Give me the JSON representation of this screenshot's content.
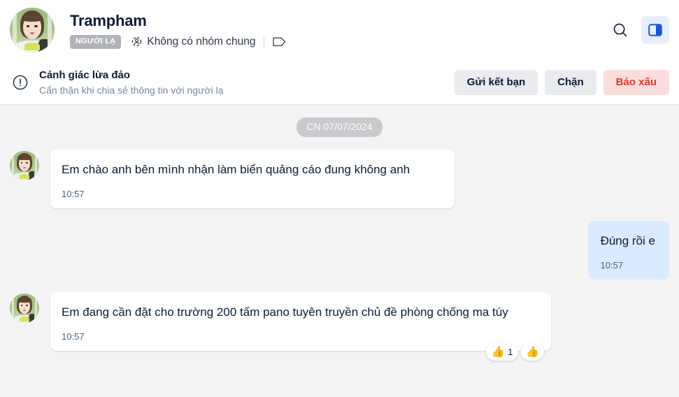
{
  "header": {
    "contact_name": "Trampham",
    "stranger_badge": "NGƯỜI LẠ",
    "group_info": "Không có nhóm chung",
    "search_icon": "search-icon",
    "sidebar_toggle_icon": "sidebar-panel-icon",
    "tag_icon": "tag-icon",
    "group_icon": "group-dotted-icon",
    "accent_blue": "#1a73e8",
    "toggle_bg": "#e7effd"
  },
  "banner": {
    "icon": "warning-circle-icon",
    "title": "Cảnh giác lừa đảo",
    "subtitle": "Cẩn thận khi chia sẻ thông tin với người lạ",
    "buttons": [
      {
        "label": "Gửi kết bạn",
        "style": "grey",
        "name": "send-friend-request-button"
      },
      {
        "label": "Chặn",
        "style": "grey",
        "name": "block-button"
      },
      {
        "label": "Báo xấu",
        "style": "danger",
        "name": "report-button"
      }
    ],
    "danger_color": "#e1382e",
    "danger_bg": "#fbdedb"
  },
  "chat": {
    "date_separator": "CN 07/07/2024",
    "messages": [
      {
        "id": "msg-1",
        "direction": "in",
        "text": "Em chào anh bên mình nhận làm biển quảng cáo đung không anh",
        "time": "10:57",
        "has_avatar": true,
        "reactions": []
      },
      {
        "id": "msg-2",
        "direction": "out",
        "text": "Đúng rồi e",
        "time": "10:57",
        "has_avatar": false,
        "reactions": []
      },
      {
        "id": "msg-3",
        "direction": "in",
        "text": "Em đang cần đặt cho trường 200 tấm pano tuyên truyền chủ đề phòng chống ma túy",
        "time": "10:57",
        "has_avatar": true,
        "reactions": [
          {
            "emoji": "👍",
            "count": "1",
            "name": "reaction-thumbsup-count"
          },
          {
            "emoji": "👍",
            "count": "",
            "name": "add-reaction-button"
          }
        ]
      }
    ],
    "bubble_in_bg": "#ffffff",
    "bubble_out_bg": "#dbebff",
    "background": "#f4f4f5"
  }
}
